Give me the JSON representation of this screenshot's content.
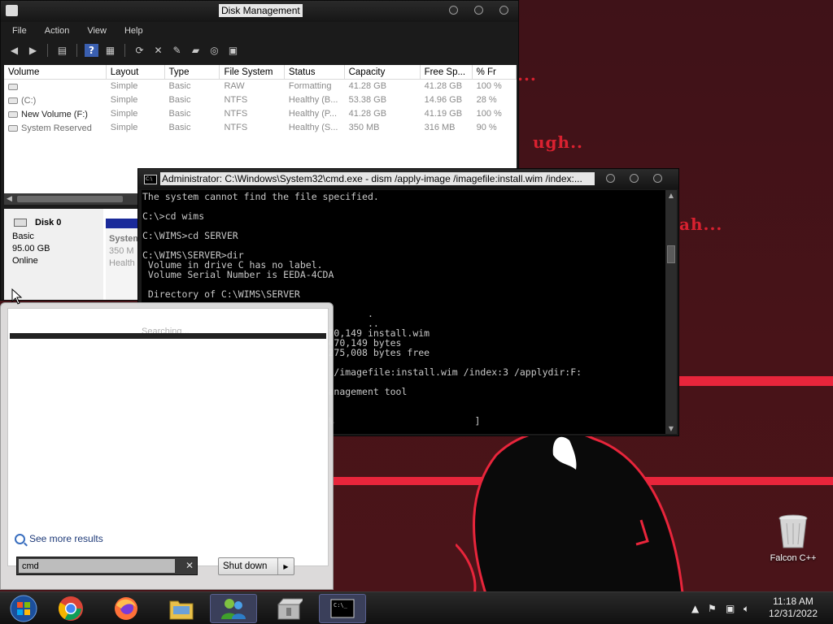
{
  "disk_management": {
    "title": "Disk Management",
    "menu": [
      "File",
      "Action",
      "View",
      "Help"
    ],
    "columns": [
      "Volume",
      "Layout",
      "Type",
      "File System",
      "Status",
      "Capacity",
      "Free Sp...",
      "% Fr"
    ],
    "rows": [
      {
        "volume": "",
        "layout": "Simple",
        "type": "Basic",
        "fs": "RAW",
        "status": "Formatting",
        "capacity": "41.28 GB",
        "free": "41.28 GB",
        "pct": "100 %"
      },
      {
        "volume": "(C:)",
        "layout": "Simple",
        "type": "Basic",
        "fs": "NTFS",
        "status": "Healthy (B...",
        "capacity": "53.38 GB",
        "free": "14.96 GB",
        "pct": "28 %"
      },
      {
        "volume": "New Volume (F:)",
        "layout": "Simple",
        "type": "Basic",
        "fs": "NTFS",
        "status": "Healthy (P...",
        "capacity": "41.28 GB",
        "free": "41.19 GB",
        "pct": "100 %"
      },
      {
        "volume": "System Reserved",
        "layout": "Simple",
        "type": "Basic",
        "fs": "NTFS",
        "status": "Healthy (S...",
        "capacity": "350 MB",
        "free": "316 MB",
        "pct": "90 %"
      }
    ],
    "disk": {
      "name": "Disk 0",
      "kind": "Basic",
      "size": "95.00 GB",
      "state": "Online"
    },
    "partition": {
      "name": "System",
      "size": "350 M",
      "status": "Health"
    }
  },
  "cmd": {
    "title": "Administrator: C:\\Windows\\System32\\cmd.exe - dism  /apply-image /imagefile:install.wim /index:...",
    "lines": [
      "The system cannot find the file specified.",
      "",
      "C:\\>cd wims",
      "",
      "C:\\WIMS>cd SERVER",
      "",
      "C:\\WIMS\\SERVER>dir",
      " Volume in drive C has no label.",
      " Volume Serial Number is EEDA-4CDA",
      "",
      " Directory of C:\\WIMS\\SERVER",
      "",
      "                                        .",
      "                                        ..",
      "                              2,470,149 install.wim",
      "                              42,470,149 bytes",
      "                              63,275,008 bytes free",
      "",
      "                              age /imagefile:install.wim /index:3 /applydir:F:",
      "",
      "                              l Management tool",
      "",
      "",
      "                              5.0%                         ]"
    ]
  },
  "start_menu": {
    "searching": "Searching...",
    "see_more": "See more results",
    "search_value": "cmd",
    "shutdown": "Shut down"
  },
  "desktop": {
    "recycle_label": "Falcon C++",
    "wallpaper_text_1": "ugh..",
    "wallpaper_text_2": "ah...",
    "wallpaper_text_3": "..."
  },
  "taskbar": {
    "apps": [
      "windows-logo-icon",
      "chrome-icon",
      "firefox-icon",
      "file-explorer-icon",
      "windows-live-messenger-icon",
      "archive-installer-icon",
      "cmd-icon"
    ],
    "time": "11:18 AM",
    "date": "12/31/2022"
  },
  "colors": {
    "accent": "#e8253b",
    "wallpaper": "#481318"
  }
}
